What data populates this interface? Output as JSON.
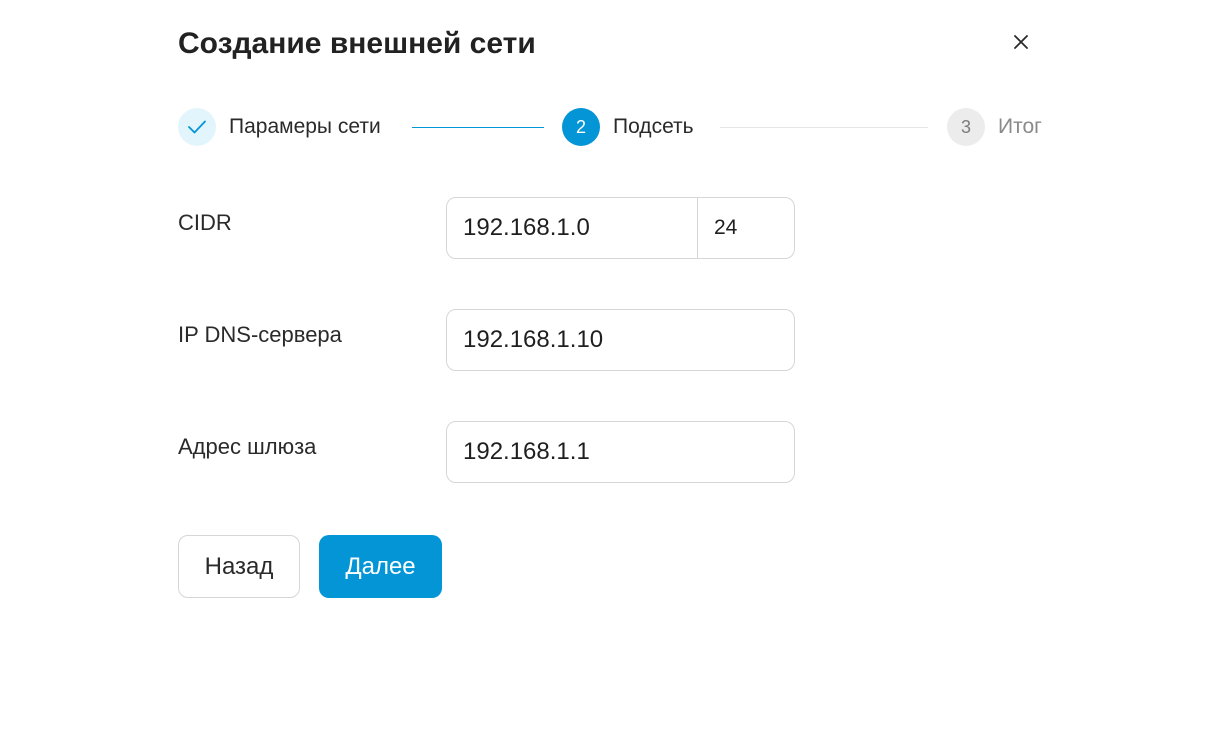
{
  "dialog": {
    "title": "Создание внешней сети"
  },
  "stepper": {
    "steps": [
      {
        "label": "Парамеры сети",
        "state": "done",
        "icon": "check-icon"
      },
      {
        "number": "2",
        "label": "Подсеть",
        "state": "active"
      },
      {
        "number": "3",
        "label": "Итог",
        "state": "future"
      }
    ]
  },
  "form": {
    "cidr": {
      "label": "CIDR",
      "ip_value": "192.168.1.0",
      "mask_value": "24"
    },
    "dns": {
      "label": "IP DNS-сервера",
      "value": "192.168.1.10"
    },
    "gateway": {
      "label": "Адрес шлюза",
      "value": "192.168.1.1"
    }
  },
  "actions": {
    "back_label": "Назад",
    "next_label": "Далее"
  },
  "colors": {
    "accent": "#0395d5",
    "done_step_bg": "#e3f5fc",
    "future_step_bg": "#ececec",
    "border": "#d6d6d6"
  }
}
